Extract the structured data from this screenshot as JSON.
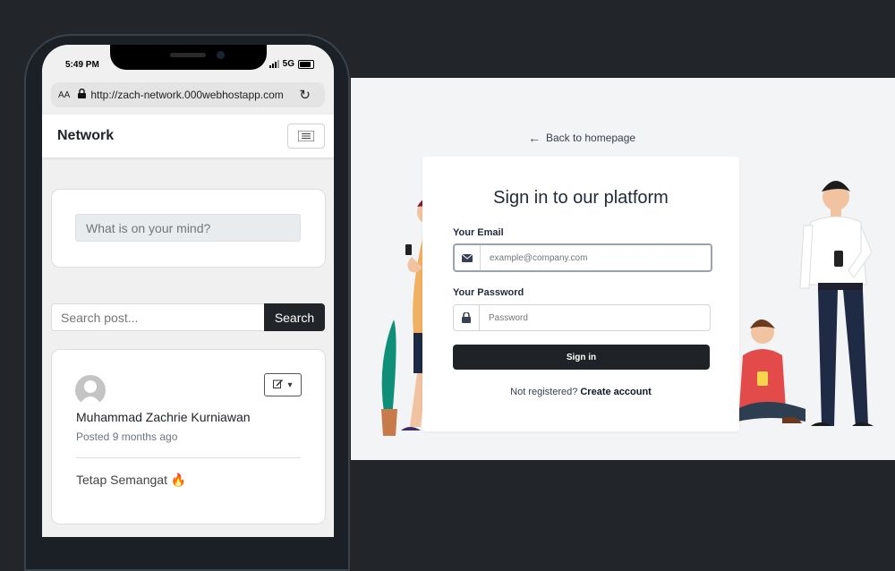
{
  "login": {
    "back_link": "Back to homepage",
    "title": "Sign in to our platform",
    "email_label": "Your Email",
    "email_placeholder": "example@company.com",
    "password_label": "Your Password",
    "password_placeholder": "Password",
    "signin_label": "Sign in",
    "not_registered": "Not registered?",
    "create_account": "Create account"
  },
  "phone": {
    "status": {
      "time": "5:49 PM",
      "network": "5G"
    },
    "browser": {
      "text_size": "AA",
      "url": "http://zach-network.000webhostapp.com"
    },
    "navbar": {
      "brand": "Network"
    },
    "composer": {
      "placeholder": "What is on your mind?"
    },
    "search": {
      "placeholder": "Search post...",
      "button": "Search"
    },
    "post": {
      "author": "Muhammad Zachrie Kurniawan",
      "posted": "Posted 9 months ago",
      "content": "Tetap Semangat 🔥"
    }
  },
  "icons": {
    "back": "arrow-left-icon",
    "email": "envelope-icon",
    "password": "lock-icon",
    "menu": "hamburger-icon",
    "edit": "pencil-icon"
  },
  "colors": {
    "primary_dark": "#1f2327",
    "page_bg": "#222529",
    "login_bg": "#f3f4f6"
  }
}
